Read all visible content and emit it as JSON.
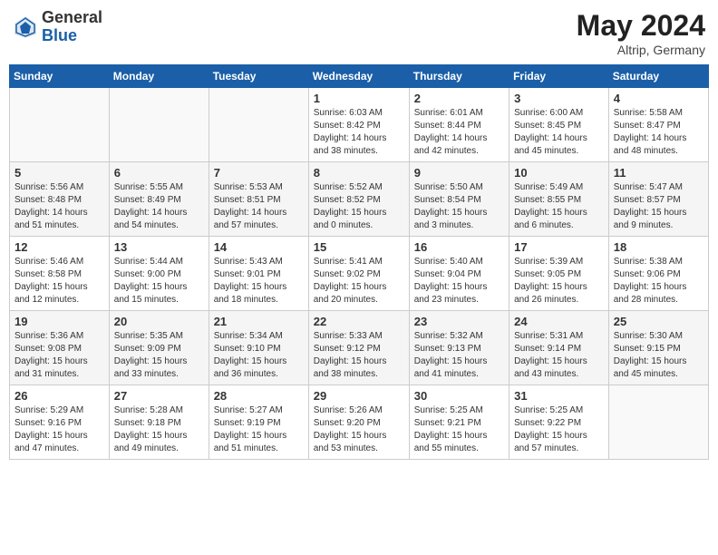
{
  "header": {
    "logo_general": "General",
    "logo_blue": "Blue",
    "month": "May 2024",
    "location": "Altrip, Germany"
  },
  "days_of_week": [
    "Sunday",
    "Monday",
    "Tuesday",
    "Wednesday",
    "Thursday",
    "Friday",
    "Saturday"
  ],
  "weeks": [
    {
      "days": [
        {
          "date": "",
          "info": ""
        },
        {
          "date": "",
          "info": ""
        },
        {
          "date": "",
          "info": ""
        },
        {
          "date": "1",
          "info": "Sunrise: 6:03 AM\nSunset: 8:42 PM\nDaylight: 14 hours\nand 38 minutes."
        },
        {
          "date": "2",
          "info": "Sunrise: 6:01 AM\nSunset: 8:44 PM\nDaylight: 14 hours\nand 42 minutes."
        },
        {
          "date": "3",
          "info": "Sunrise: 6:00 AM\nSunset: 8:45 PM\nDaylight: 14 hours\nand 45 minutes."
        },
        {
          "date": "4",
          "info": "Sunrise: 5:58 AM\nSunset: 8:47 PM\nDaylight: 14 hours\nand 48 minutes."
        }
      ]
    },
    {
      "days": [
        {
          "date": "5",
          "info": "Sunrise: 5:56 AM\nSunset: 8:48 PM\nDaylight: 14 hours\nand 51 minutes."
        },
        {
          "date": "6",
          "info": "Sunrise: 5:55 AM\nSunset: 8:49 PM\nDaylight: 14 hours\nand 54 minutes."
        },
        {
          "date": "7",
          "info": "Sunrise: 5:53 AM\nSunset: 8:51 PM\nDaylight: 14 hours\nand 57 minutes."
        },
        {
          "date": "8",
          "info": "Sunrise: 5:52 AM\nSunset: 8:52 PM\nDaylight: 15 hours\nand 0 minutes."
        },
        {
          "date": "9",
          "info": "Sunrise: 5:50 AM\nSunset: 8:54 PM\nDaylight: 15 hours\nand 3 minutes."
        },
        {
          "date": "10",
          "info": "Sunrise: 5:49 AM\nSunset: 8:55 PM\nDaylight: 15 hours\nand 6 minutes."
        },
        {
          "date": "11",
          "info": "Sunrise: 5:47 AM\nSunset: 8:57 PM\nDaylight: 15 hours\nand 9 minutes."
        }
      ]
    },
    {
      "days": [
        {
          "date": "12",
          "info": "Sunrise: 5:46 AM\nSunset: 8:58 PM\nDaylight: 15 hours\nand 12 minutes."
        },
        {
          "date": "13",
          "info": "Sunrise: 5:44 AM\nSunset: 9:00 PM\nDaylight: 15 hours\nand 15 minutes."
        },
        {
          "date": "14",
          "info": "Sunrise: 5:43 AM\nSunset: 9:01 PM\nDaylight: 15 hours\nand 18 minutes."
        },
        {
          "date": "15",
          "info": "Sunrise: 5:41 AM\nSunset: 9:02 PM\nDaylight: 15 hours\nand 20 minutes."
        },
        {
          "date": "16",
          "info": "Sunrise: 5:40 AM\nSunset: 9:04 PM\nDaylight: 15 hours\nand 23 minutes."
        },
        {
          "date": "17",
          "info": "Sunrise: 5:39 AM\nSunset: 9:05 PM\nDaylight: 15 hours\nand 26 minutes."
        },
        {
          "date": "18",
          "info": "Sunrise: 5:38 AM\nSunset: 9:06 PM\nDaylight: 15 hours\nand 28 minutes."
        }
      ]
    },
    {
      "days": [
        {
          "date": "19",
          "info": "Sunrise: 5:36 AM\nSunset: 9:08 PM\nDaylight: 15 hours\nand 31 minutes."
        },
        {
          "date": "20",
          "info": "Sunrise: 5:35 AM\nSunset: 9:09 PM\nDaylight: 15 hours\nand 33 minutes."
        },
        {
          "date": "21",
          "info": "Sunrise: 5:34 AM\nSunset: 9:10 PM\nDaylight: 15 hours\nand 36 minutes."
        },
        {
          "date": "22",
          "info": "Sunrise: 5:33 AM\nSunset: 9:12 PM\nDaylight: 15 hours\nand 38 minutes."
        },
        {
          "date": "23",
          "info": "Sunrise: 5:32 AM\nSunset: 9:13 PM\nDaylight: 15 hours\nand 41 minutes."
        },
        {
          "date": "24",
          "info": "Sunrise: 5:31 AM\nSunset: 9:14 PM\nDaylight: 15 hours\nand 43 minutes."
        },
        {
          "date": "25",
          "info": "Sunrise: 5:30 AM\nSunset: 9:15 PM\nDaylight: 15 hours\nand 45 minutes."
        }
      ]
    },
    {
      "days": [
        {
          "date": "26",
          "info": "Sunrise: 5:29 AM\nSunset: 9:16 PM\nDaylight: 15 hours\nand 47 minutes."
        },
        {
          "date": "27",
          "info": "Sunrise: 5:28 AM\nSunset: 9:18 PM\nDaylight: 15 hours\nand 49 minutes."
        },
        {
          "date": "28",
          "info": "Sunrise: 5:27 AM\nSunset: 9:19 PM\nDaylight: 15 hours\nand 51 minutes."
        },
        {
          "date": "29",
          "info": "Sunrise: 5:26 AM\nSunset: 9:20 PM\nDaylight: 15 hours\nand 53 minutes."
        },
        {
          "date": "30",
          "info": "Sunrise: 5:25 AM\nSunset: 9:21 PM\nDaylight: 15 hours\nand 55 minutes."
        },
        {
          "date": "31",
          "info": "Sunrise: 5:25 AM\nSunset: 9:22 PM\nDaylight: 15 hours\nand 57 minutes."
        },
        {
          "date": "",
          "info": ""
        }
      ]
    }
  ]
}
